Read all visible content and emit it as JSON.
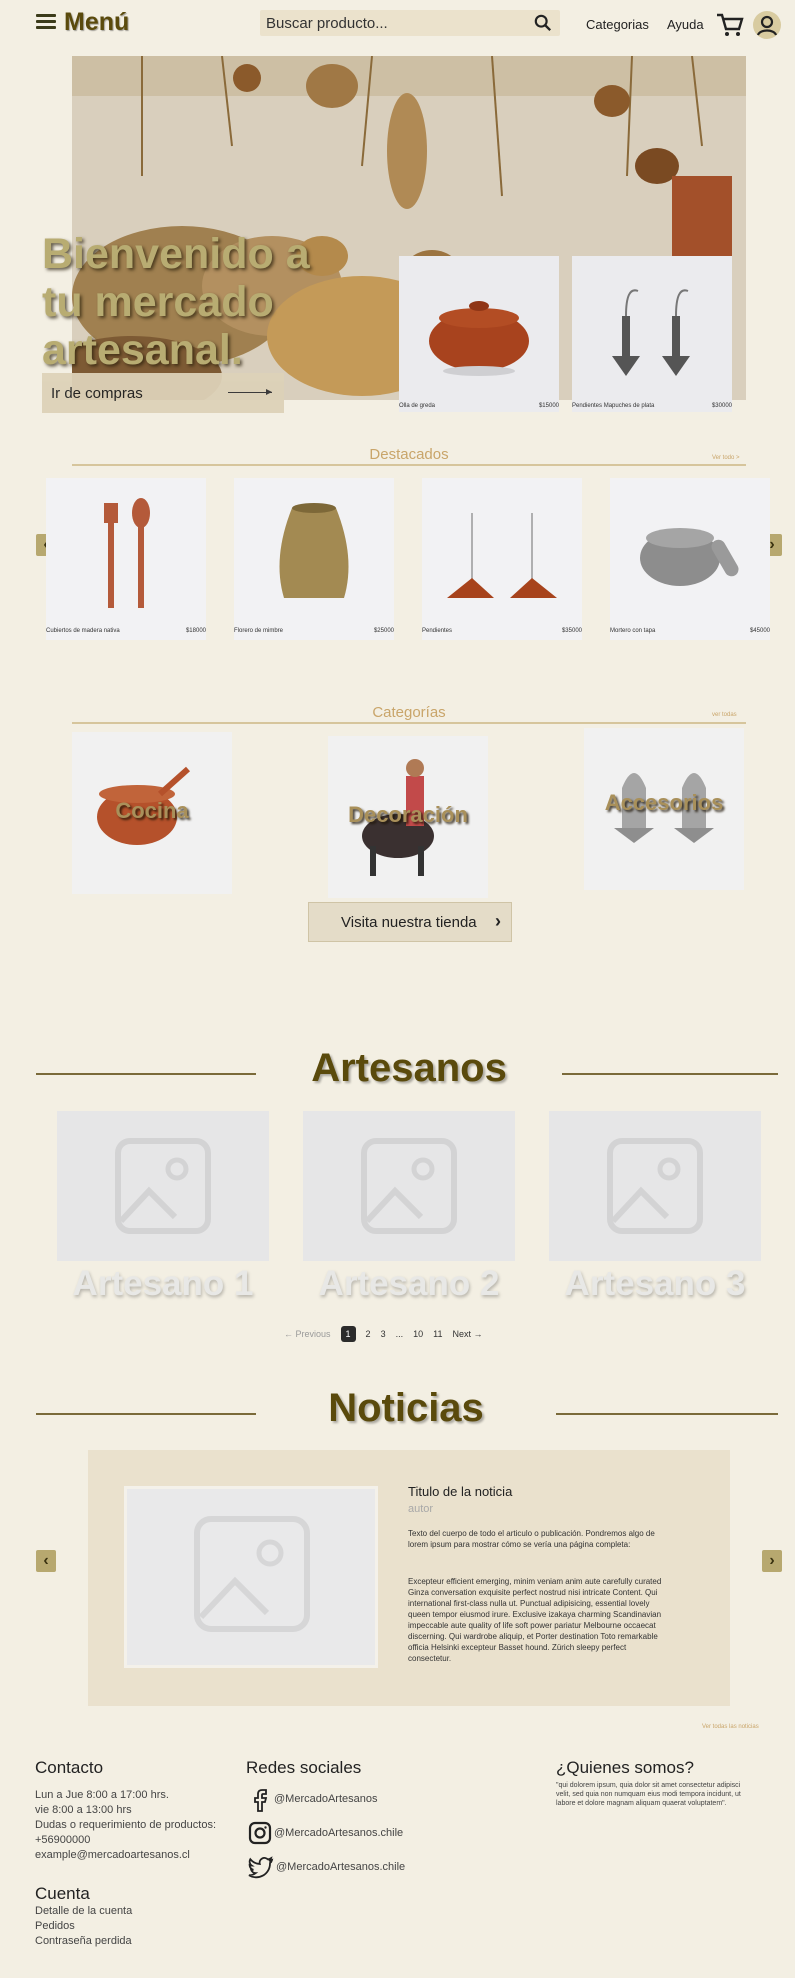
{
  "header": {
    "menu_label": "Menú",
    "search_placeholder": "Buscar producto...",
    "nav": [
      "Categorias",
      "Ayuda"
    ]
  },
  "hero": {
    "title": "Bienvenido a tu mercado artesanal.",
    "button": "Ir de compras",
    "cards": [
      {
        "name": "Olla de greda",
        "price": "$15000"
      },
      {
        "name": "Pendientes Mapuches de plata",
        "price": "$30000"
      }
    ]
  },
  "featured": {
    "title": "Destacados",
    "see_all": "Ver todo >",
    "items": [
      {
        "name": "Cubiertos de madera nativa",
        "price": "$18000"
      },
      {
        "name": "Florero de mimbre",
        "price": "$25000"
      },
      {
        "name": "Pendientes",
        "price": "$35000"
      },
      {
        "name": "Mortero con tapa",
        "price": "$45000"
      }
    ]
  },
  "categories": {
    "title": "Categorías",
    "see_all": "ver todas",
    "items": [
      "Cocina",
      "Decoración",
      "Accesorios"
    ],
    "button": "Visita nuestra tienda"
  },
  "artisans": {
    "title": "Artesanos",
    "items": [
      "Artesano 1",
      "Artesano 2",
      "Artesano 3"
    ],
    "pagination": {
      "prev": "← Previous",
      "pages": [
        "1",
        "2",
        "3",
        "...",
        "10",
        "11"
      ],
      "next": "Next →"
    }
  },
  "news": {
    "title": "Noticias",
    "item_title": "Titulo de la noticia",
    "author": "autor",
    "body1": "Texto del cuerpo de todo el articulo o publicación. Pondremos algo de lorem ipsum para mostrar cómo se vería una página completa:",
    "body2": "Excepteur efficient emerging, minim veniam anim aute carefully curated Ginza conversation exquisite perfect nostrud nisi intricate Content. Qui international first-class nulla ut. Punctual adipisicing, essential lovely queen tempor eiusmod irure. Exclusive izakaya charming Scandinavian impeccable aute quality of life soft power pariatur Melbourne occaecat discerning. Qui wardrobe aliquip, et Porter destination Toto remarkable officia Helsinki excepteur Basset hound. Zürich sleepy perfect consectetur.",
    "see_all": "Ver todas las noticias"
  },
  "footer": {
    "contact_title": "Contacto",
    "contact_lines": [
      "Lun a Jue 8:00 a 17:00 hrs.",
      "vie 8:00 a 13:00 hrs",
      "Dudas o requerimiento de productos:",
      "+56900000",
      "example@mercadoartesanos.cl"
    ],
    "social_title": "Redes sociales",
    "social": [
      "@MercadoArtesanos",
      "@MercadoArtesanos.chile",
      "@MercadoArtesanos.chile"
    ],
    "about_title": "¿Quienes somos?",
    "about_text": "\"qui dolorem ipsum, quia dolor sit amet consectetur adipisci velit, sed quia non numquam eius modi tempora incidunt, ut labore et dolore magnam aliquam quaerat voluptatem\".",
    "account_title": "Cuenta",
    "account_links": [
      "Detalle de la cuenta",
      "Pedidos",
      "Contraseña perdida"
    ]
  }
}
